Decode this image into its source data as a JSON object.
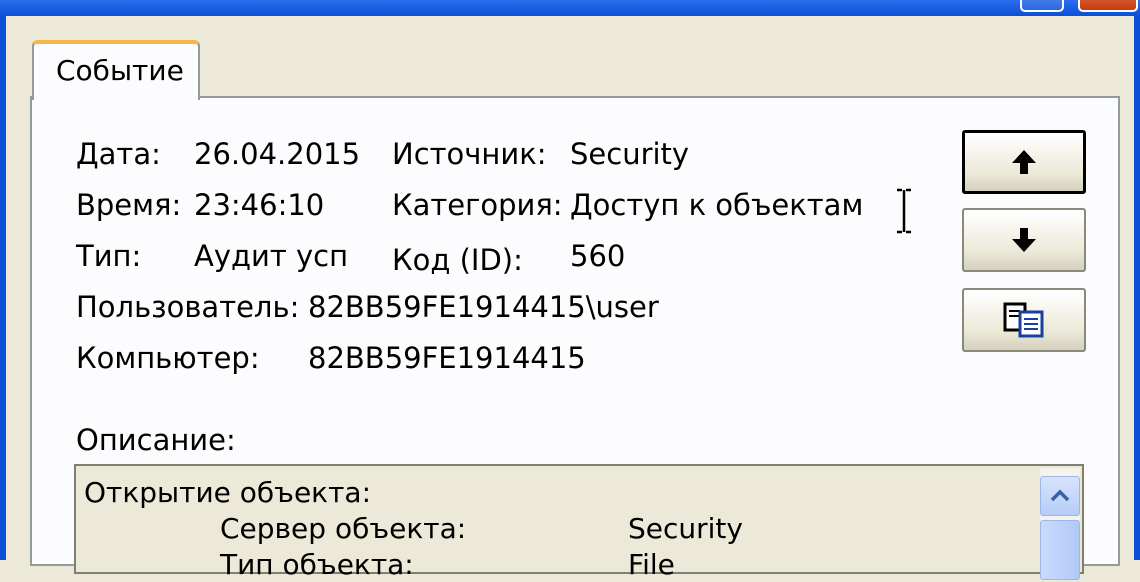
{
  "window": {
    "tab_label": "Событие"
  },
  "fields": {
    "date_label": "Дата:",
    "date_value": "26.04.2015",
    "source_label": "Источник:",
    "source_value": "Security",
    "time_label": "Время:",
    "time_value": "23:46:10",
    "category_label": "Категория:",
    "category_value": "Доступ к объектам",
    "type_label": "Тип:",
    "type_value": "Аудит усп",
    "id_label": "Код (ID):",
    "id_value": "560",
    "user_label": "Пользователь:",
    "user_value": "82BB59FE1914415\\user",
    "computer_label": "Компьютер:",
    "computer_value": "82BB59FE1914415"
  },
  "description": {
    "label": "Описание:",
    "lines": [
      {
        "key": "Открытие объекта:",
        "value": ""
      },
      {
        "key": "Сервер объекта:",
        "value": "Security"
      },
      {
        "key": "Тип объекта:",
        "value": "File"
      }
    ]
  },
  "buttons": {
    "up_icon": "arrow-up-icon",
    "down_icon": "arrow-down-icon",
    "copy_icon": "copy-icon"
  }
}
